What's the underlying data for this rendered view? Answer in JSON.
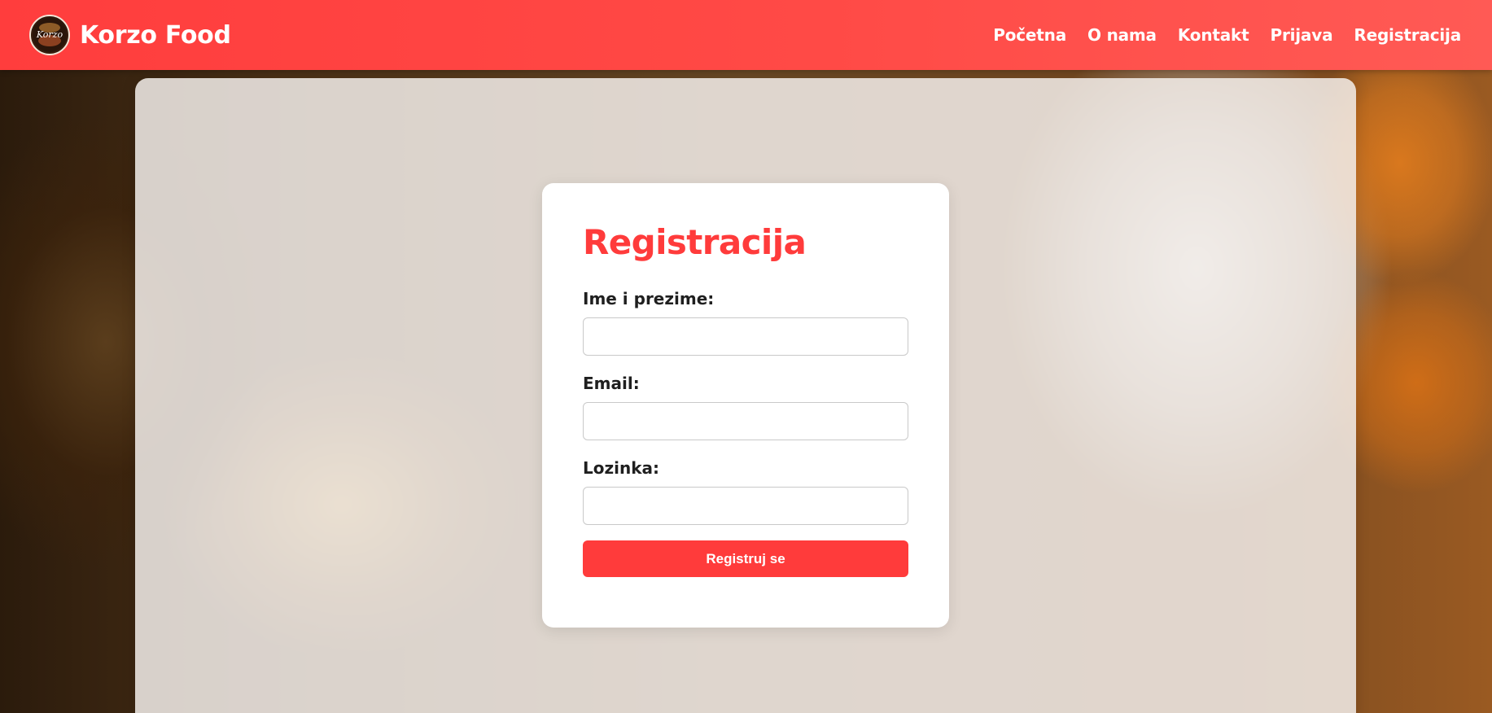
{
  "navbar": {
    "brand_name": "Korzo Food",
    "logo_text": "Korzo",
    "links": [
      {
        "label": "Početna"
      },
      {
        "label": "O nama"
      },
      {
        "label": "Kontakt"
      },
      {
        "label": "Prijava"
      },
      {
        "label": "Registracija"
      }
    ],
    "background_color": "#ff4444",
    "text_color": "#ffffff"
  },
  "form": {
    "title": "Registracija",
    "fields": [
      {
        "label": "Ime i prezime:",
        "value": "",
        "placeholder": ""
      },
      {
        "label": "Email:",
        "value": "",
        "placeholder": ""
      },
      {
        "label": "Lozinka:",
        "value": "",
        "placeholder": ""
      }
    ],
    "submit_label": "Registruj se",
    "accent_color": "#ff3b3b"
  },
  "icons": {
    "logo": "korzo-logo-icon"
  }
}
